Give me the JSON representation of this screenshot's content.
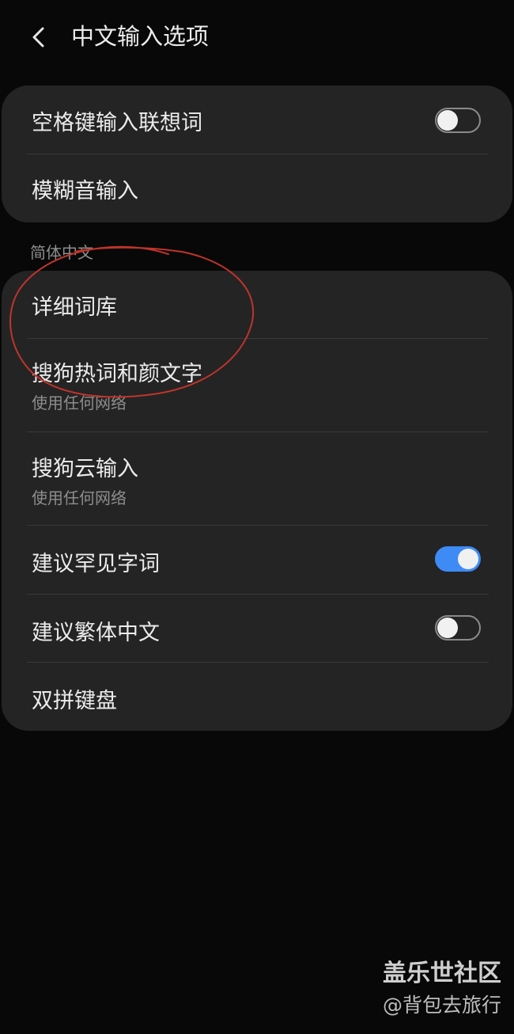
{
  "header": {
    "title": "中文输入选项",
    "back_icon": "chevron-left-icon"
  },
  "group1": {
    "items": [
      {
        "title": "空格键输入联想词",
        "toggle": false
      },
      {
        "title": "模糊音输入"
      }
    ]
  },
  "section": {
    "title": "简体中文"
  },
  "group2": {
    "items": [
      {
        "title": "详细词库"
      },
      {
        "title": "搜狗热词和颜文字",
        "subtitle": "使用任何网络"
      },
      {
        "title": "搜狗云输入",
        "subtitle": "使用任何网络"
      },
      {
        "title": "建议罕见字词",
        "toggle": true
      },
      {
        "title": "建议繁体中文",
        "toggle": false
      },
      {
        "title": "双拼键盘"
      }
    ]
  },
  "colors": {
    "background": "#080808",
    "card": "#242424",
    "accent": "#3e8bf5",
    "annotation": "#c0342b"
  },
  "watermark": {
    "title": "盖乐世社区",
    "user": "@背包去旅行"
  }
}
